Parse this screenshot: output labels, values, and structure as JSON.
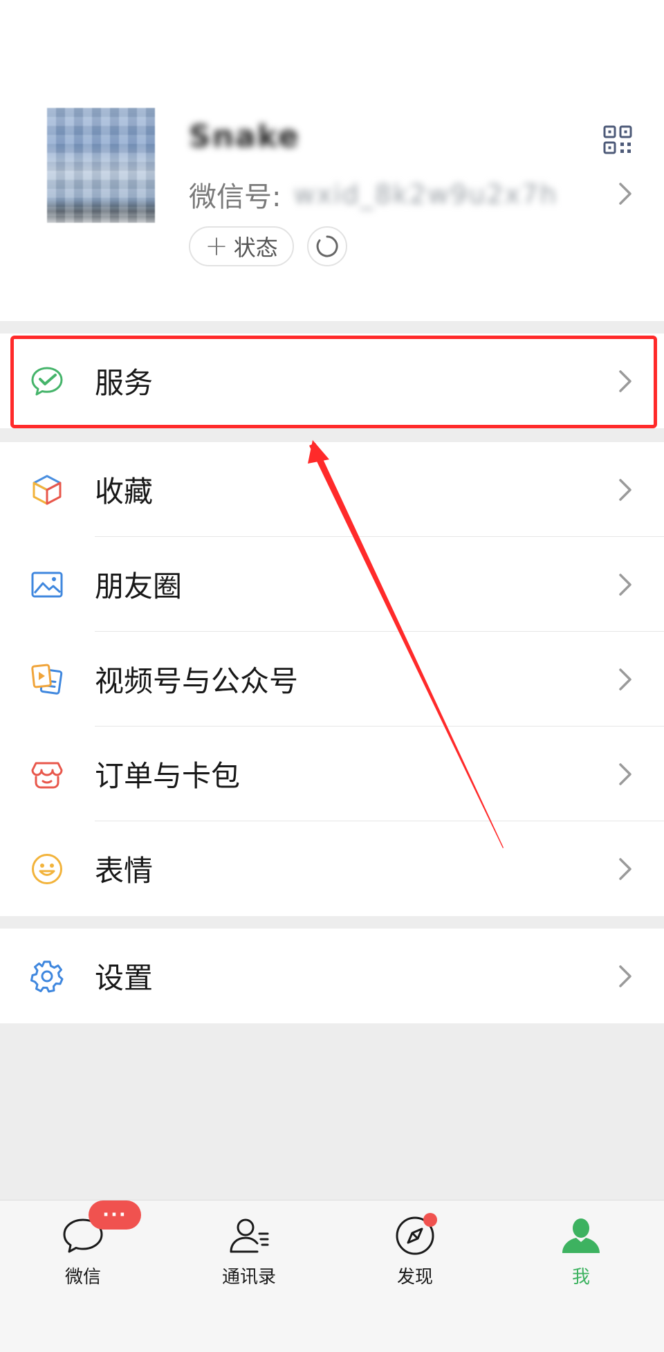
{
  "profile": {
    "nickname": "Snake",
    "wechat_id_label": "微信号:",
    "wechat_id_value": "wxid_8k2w9u2x7h",
    "status_button_label": "状态",
    "status_plus": "+"
  },
  "menu": {
    "service": {
      "label": "服务",
      "icon": "wechat-pay-icon"
    },
    "group2": [
      {
        "label": "收藏",
        "icon": "favorites-cube-icon"
      },
      {
        "label": "朋友圈",
        "icon": "moments-image-icon"
      },
      {
        "label": "视频号与公众号",
        "icon": "channels-icon"
      },
      {
        "label": "订单与卡包",
        "icon": "orders-cards-icon"
      },
      {
        "label": "表情",
        "icon": "emoji-smile-icon"
      }
    ],
    "settings": {
      "label": "设置",
      "icon": "settings-gear-icon"
    }
  },
  "tabbar": {
    "tabs": [
      {
        "label": "微信",
        "icon": "chat-bubble-icon",
        "active": false
      },
      {
        "label": "通讯录",
        "icon": "contacts-icon",
        "active": false
      },
      {
        "label": "发现",
        "icon": "discover-compass-icon",
        "active": false
      },
      {
        "label": "我",
        "icon": "me-person-icon",
        "active": true
      }
    ],
    "chat_badge": "···"
  },
  "colors": {
    "accent_green": "#3db260",
    "highlight_red": "#ff2a2a",
    "badge_red": "#f0524f",
    "background": "#ededed"
  }
}
